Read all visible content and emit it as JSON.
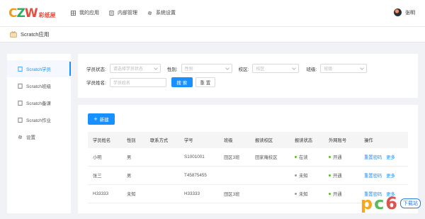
{
  "app": {
    "logo_letters": [
      "C",
      "Z",
      "W"
    ],
    "logo_text": "彩纸屋",
    "brand_colors": {
      "c": "#f39c12",
      "z": "#27ae60",
      "w": "#e74c3c"
    }
  },
  "topnav": [
    {
      "label": "我的应用",
      "icon": "grid-icon"
    },
    {
      "label": "内部管理",
      "icon": "document-icon"
    },
    {
      "label": "系统设置",
      "icon": "gear-icon"
    }
  ],
  "user": {
    "name": "张明"
  },
  "subheader": {
    "title": "Scratch应用",
    "icon": "app-icon"
  },
  "sidebar": {
    "items": [
      {
        "label": "Scratch学员",
        "icon": "document-icon",
        "active": true
      },
      {
        "label": "Scratch班级",
        "icon": "document-icon",
        "active": false
      },
      {
        "label": "Scratch备课",
        "icon": "document-icon",
        "active": false
      },
      {
        "label": "Scratch作业",
        "icon": "document-icon",
        "active": false
      },
      {
        "label": "设置",
        "icon": "gear-icon",
        "active": false
      }
    ]
  },
  "filters": {
    "status_label": "学员状态:",
    "status_placeholder": "请选择学员状态",
    "gender_label": "性别:",
    "gender_placeholder": "性别",
    "campus_label": "校区:",
    "campus_placeholder": "校区",
    "class_label": "班级:",
    "class_placeholder": "班级",
    "name_label": "学员姓名:",
    "name_placeholder": "学员姓名",
    "search_label": "搜 索",
    "reset_label": "重 置"
  },
  "table": {
    "add_label": "新建",
    "columns": [
      "学员姓名",
      "性别",
      "联系方式",
      "学号",
      "班级",
      "报读校区",
      "报读状态",
      "外网账号",
      "操作"
    ],
    "rows": [
      {
        "name": "小明",
        "gender": "男",
        "contact": "",
        "student_id": "S1001001",
        "class": "田区3班",
        "campus": "田家庵校区",
        "status": "在读",
        "status_color": "#52c41a",
        "account": "开通",
        "account_color": "#52c41a",
        "action_reset": "重置密码",
        "action_more": "更多"
      },
      {
        "name": "张三",
        "gender": "男",
        "contact": "",
        "student_id": "T45875455",
        "class": "",
        "campus": "",
        "status": "未知",
        "status_color": "#999999",
        "account": "开通",
        "account_color": "#52c41a",
        "action_reset": "重置密码",
        "action_more": "更多"
      },
      {
        "name": "H33333",
        "gender": "未知",
        "contact": "",
        "student_id": "H33333",
        "class": "田区3班",
        "campus": "",
        "status": "未知",
        "status_color": "#999999",
        "account": "开通",
        "account_color": "#52c41a",
        "action_reset": "重置密码",
        "action_more": "更多"
      }
    ]
  },
  "watermark": {
    "letters": [
      "p",
      "c",
      "6"
    ],
    "badge": "下载站"
  }
}
